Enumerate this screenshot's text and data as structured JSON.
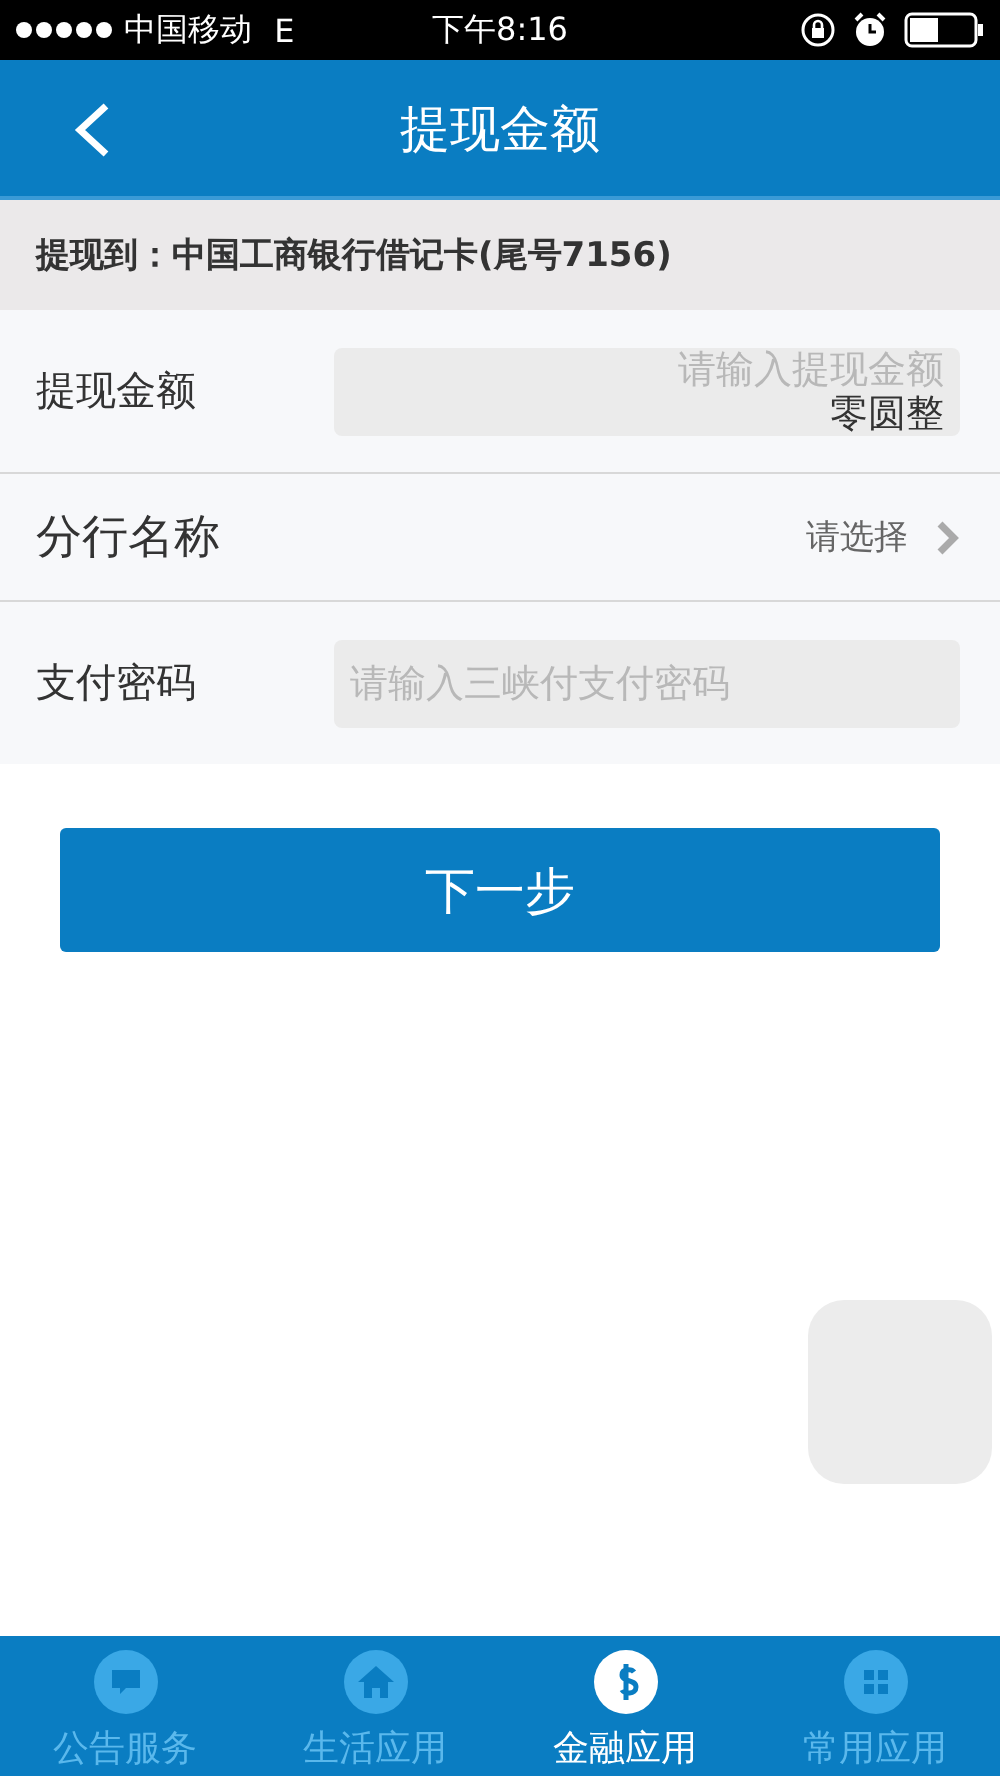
{
  "status_bar": {
    "carrier": "中国移动",
    "network": "E",
    "time": "下午8:16"
  },
  "header": {
    "title": "提现金额"
  },
  "bank_line": "提现到：中国工商银行借记卡(尾号7156)",
  "form": [
    {
      "kind": "input",
      "label": "提现金额",
      "placeholder": "请输入提现金额",
      "note": "零圆整"
    },
    {
      "kind": "select",
      "label": "分行名称",
      "value": "请选择"
    },
    {
      "kind": "input",
      "label": "支付密码",
      "placeholder": "请输入三峡付支付密码"
    }
  ],
  "next_button": "下一步",
  "tab_bar": [
    {
      "label": "公告服务",
      "kind": "chat",
      "selected": false
    },
    {
      "label": "生活应用",
      "kind": "home",
      "selected": false
    },
    {
      "label": "金融应用",
      "kind": "dollar",
      "selected": true
    },
    {
      "label": "常用应用",
      "kind": "grid",
      "selected": false
    }
  ]
}
